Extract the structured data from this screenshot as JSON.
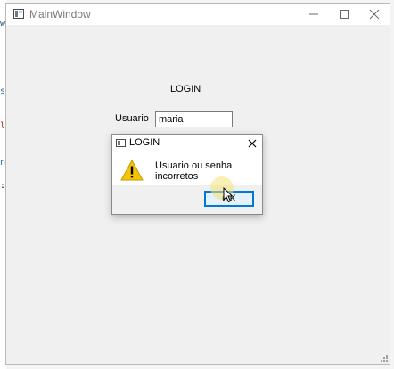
{
  "window": {
    "title": "MainWindow",
    "min_glyph": "—",
    "max_glyph": "☐",
    "close_glyph": "✕"
  },
  "main": {
    "heading": "LOGIN",
    "usuario_label": "Usuario",
    "usuario_value": "maria"
  },
  "dialog": {
    "title": "LOGIN",
    "close_glyph": "✕",
    "message": "Usuario ou senha incorretos",
    "icon": "warning-icon",
    "ok_label": "OK"
  },
  "colors": {
    "accent": "#0078d7",
    "warning": "#f5c400"
  }
}
